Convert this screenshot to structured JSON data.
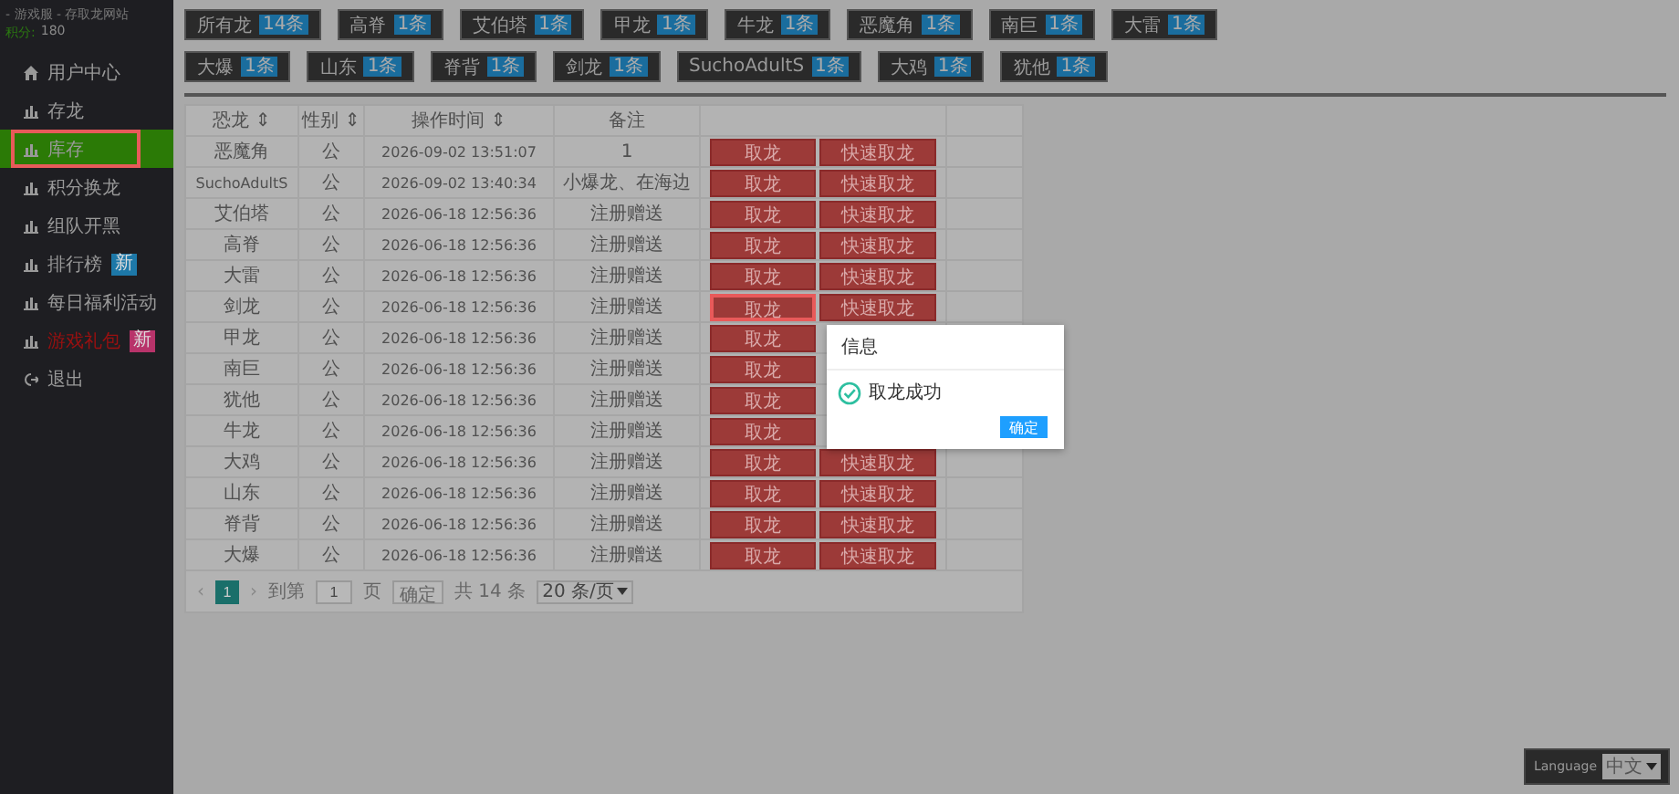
{
  "sidebar": {
    "site_title": "- 游戏服 - 存取龙网站",
    "points_label": "积分:",
    "points": "180",
    "items": [
      {
        "kind": "home",
        "label": "用户中心",
        "selected": false,
        "highlighted": false
      },
      {
        "kind": "chart",
        "label": "存龙",
        "selected": false,
        "highlighted": false
      },
      {
        "kind": "chart",
        "label": "库存",
        "selected": true,
        "highlighted": true
      },
      {
        "kind": "chart",
        "label": "积分换龙",
        "selected": false,
        "highlighted": false
      },
      {
        "kind": "chart",
        "label": "组队开黑",
        "selected": false,
        "highlighted": false
      },
      {
        "kind": "chart",
        "label": "排行榜",
        "selected": false,
        "highlighted": false,
        "badge": {
          "text": "新",
          "color": "#1d78a8"
        }
      },
      {
        "kind": "chart",
        "label": "每日福利活动",
        "selected": false,
        "highlighted": false
      },
      {
        "kind": "chart",
        "label": "游戏礼包",
        "selected": false,
        "highlighted": false,
        "badge": {
          "text": "新",
          "color": "#b8336a"
        },
        "alert": true
      },
      {
        "kind": "logout",
        "label": "退出",
        "selected": false,
        "highlighted": false
      }
    ]
  },
  "tag_rows": [
    [
      {
        "name": "所有龙",
        "count": "14条"
      },
      {
        "name": "高脊",
        "count": "1条"
      },
      {
        "name": "艾伯塔",
        "count": "1条"
      },
      {
        "name": "甲龙",
        "count": "1条"
      },
      {
        "name": "牛龙",
        "count": "1条"
      },
      {
        "name": "恶魔角",
        "count": "1条"
      },
      {
        "name": "南巨",
        "count": "1条"
      },
      {
        "name": "大雷",
        "count": "1条"
      }
    ],
    [
      {
        "name": "大爆",
        "count": "1条"
      },
      {
        "name": "山东",
        "count": "1条"
      },
      {
        "name": "脊背",
        "count": "1条"
      },
      {
        "name": "剑龙",
        "count": "1条"
      },
      {
        "name": "SuchoAdultS",
        "count": "1条"
      },
      {
        "name": "大鸡",
        "count": "1条"
      },
      {
        "name": "犹他",
        "count": "1条"
      }
    ]
  ],
  "table": {
    "columns": [
      {
        "label": "恐龙",
        "sort": "⇕"
      },
      {
        "label": "性别",
        "sort": "⇕"
      },
      {
        "label": "操作时间",
        "sort": "⇕"
      },
      {
        "label": "备注"
      }
    ],
    "rows": [
      {
        "dino": "恶魔角",
        "sex": "公",
        "time": "2026-09-02 13:51:07",
        "note": "1",
        "actions": [
          "取龙",
          "快速取龙"
        ],
        "highlighted": false
      },
      {
        "dino": "SuchoAdultS",
        "sex": "公",
        "time": "2026-09-02 13:40:34",
        "note": "小爆龙、在海边",
        "actions": [
          "取龙",
          "快速取龙"
        ],
        "highlighted": false
      },
      {
        "dino": "艾伯塔",
        "sex": "公",
        "time": "2026-06-18 12:56:36",
        "note": "注册赠送",
        "actions": [
          "取龙",
          "快速取龙"
        ],
        "highlighted": false
      },
      {
        "dino": "高脊",
        "sex": "公",
        "time": "2026-06-18 12:56:36",
        "note": "注册赠送",
        "actions": [
          "取龙",
          "快速取龙"
        ],
        "highlighted": false
      },
      {
        "dino": "大雷",
        "sex": "公",
        "time": "2026-06-18 12:56:36",
        "note": "注册赠送",
        "actions": [
          "取龙",
          "快速取龙"
        ],
        "highlighted": false
      },
      {
        "dino": "剑龙",
        "sex": "公",
        "time": "2026-06-18 12:56:36",
        "note": "注册赠送",
        "actions": [
          "取龙",
          "快速取龙"
        ],
        "highlighted": true
      },
      {
        "dino": "甲龙",
        "sex": "公",
        "time": "2026-06-18 12:56:36",
        "note": "注册赠送",
        "actions": [
          "取龙"
        ],
        "highlighted": false
      },
      {
        "dino": "南巨",
        "sex": "公",
        "time": "2026-06-18 12:56:36",
        "note": "注册赠送",
        "actions": [
          "取龙"
        ],
        "highlighted": false
      },
      {
        "dino": "犹他",
        "sex": "公",
        "time": "2026-06-18 12:56:36",
        "note": "注册赠送",
        "actions": [
          "取龙"
        ],
        "highlighted": false
      },
      {
        "dino": "牛龙",
        "sex": "公",
        "time": "2026-06-18 12:56:36",
        "note": "注册赠送",
        "actions": [
          "取龙"
        ],
        "highlighted": false
      },
      {
        "dino": "大鸡",
        "sex": "公",
        "time": "2026-06-18 12:56:36",
        "note": "注册赠送",
        "actions": [
          "取龙",
          "快速取龙"
        ],
        "highlighted": false
      },
      {
        "dino": "山东",
        "sex": "公",
        "time": "2026-06-18 12:56:36",
        "note": "注册赠送",
        "actions": [
          "取龙",
          "快速取龙"
        ],
        "highlighted": false
      },
      {
        "dino": "脊背",
        "sex": "公",
        "time": "2026-06-18 12:56:36",
        "note": "注册赠送",
        "actions": [
          "取龙",
          "快速取龙"
        ],
        "highlighted": false
      },
      {
        "dino": "大爆",
        "sex": "公",
        "time": "2026-06-18 12:56:36",
        "note": "注册赠送",
        "actions": [
          "取龙",
          "快速取龙"
        ],
        "highlighted": false
      }
    ]
  },
  "pagination": {
    "prev": "‹",
    "pages": [
      {
        "label": "1",
        "selected": true
      }
    ],
    "next": "›",
    "goto_label": "到第",
    "page_value": "1",
    "page_suffix": "页",
    "confirm": "确定",
    "total": "共 14 条",
    "page_size": "20 条/页"
  },
  "dialog": {
    "title": "信息",
    "message": "取龙成功",
    "button": "确定"
  },
  "language": {
    "label": "Language",
    "value": "中文"
  }
}
